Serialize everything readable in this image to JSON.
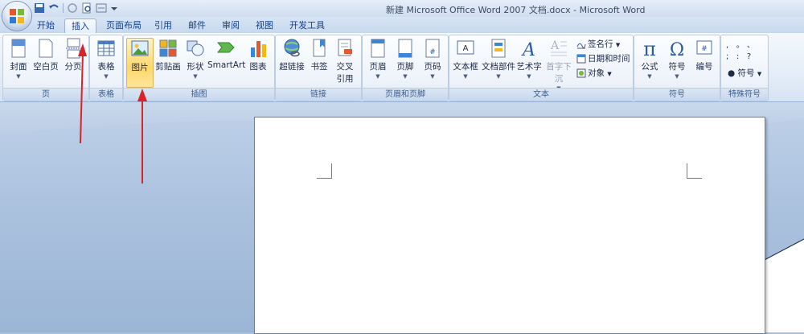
{
  "window": {
    "title": "新建 Microsoft Office Word 2007 文档.docx - Microsoft Word"
  },
  "tabs": [
    "开始",
    "插入",
    "页面布局",
    "引用",
    "邮件",
    "审阅",
    "视图",
    "开发工具"
  ],
  "active_tab": "插入",
  "ribbon": {
    "page_group": {
      "label": "页",
      "buttons": [
        "封面",
        "空白页",
        "分页"
      ]
    },
    "table_group": {
      "label": "表格",
      "buttons": [
        "表格"
      ]
    },
    "illustrations_group": {
      "label": "插图",
      "buttons": [
        "图片",
        "剪贴画",
        "形状",
        "SmartArt",
        "图表"
      ]
    },
    "links_group": {
      "label": "链接",
      "buttons": [
        "超链接",
        "书签",
        "交叉",
        "引用"
      ]
    },
    "header_footer_group": {
      "label": "页眉和页脚",
      "buttons": [
        "页眉",
        "页脚",
        "页码"
      ]
    },
    "text_group": {
      "label": "文本",
      "buttons": [
        "文本框",
        "文档部件",
        "艺术字",
        "首字下沉"
      ],
      "small_buttons": [
        "签名行",
        "日期和时间",
        "对象"
      ]
    },
    "symbols_group": {
      "label": "符号",
      "buttons": [
        "公式",
        "符号",
        "编号"
      ]
    },
    "special_group": {
      "label": "特殊符号",
      "symbol_button": "符号"
    }
  },
  "colors": {
    "accent": "#15428b",
    "selected": "#ffd86b",
    "annotation_arrow": "#d8232a"
  }
}
